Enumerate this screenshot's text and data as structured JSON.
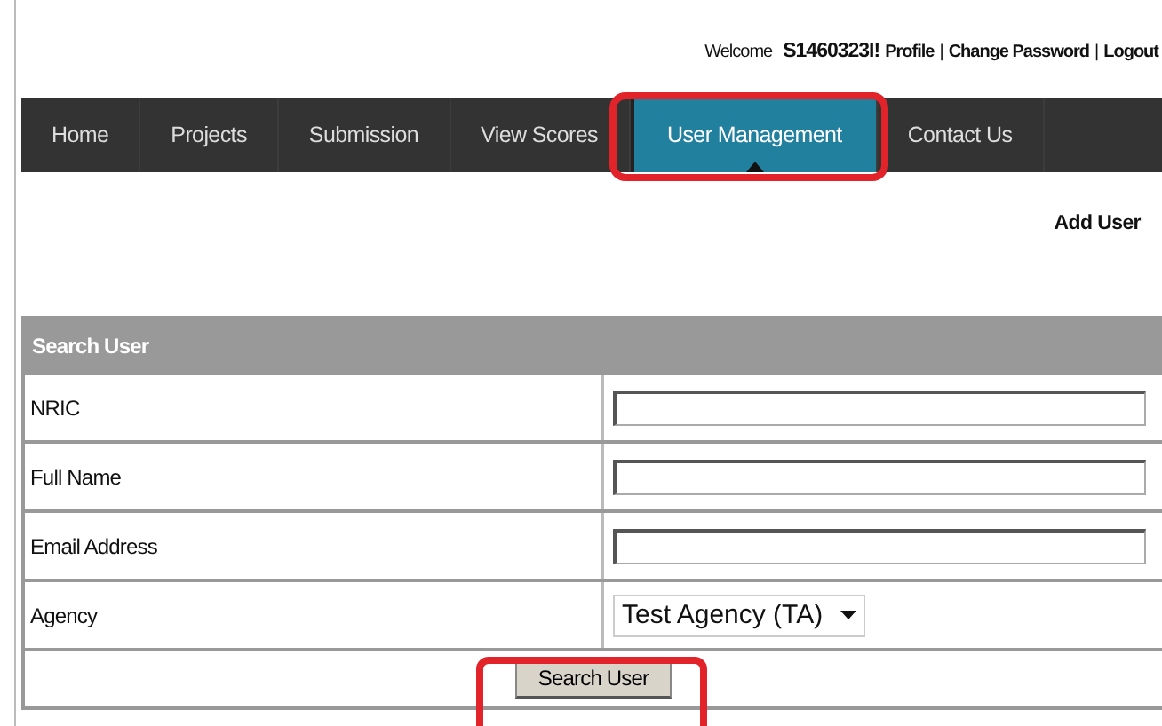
{
  "header": {
    "greeting": "Welcome",
    "user": "S1460323I!",
    "links": [
      {
        "label": "Profile"
      },
      {
        "label": "Change Password"
      },
      {
        "label": "Logout"
      }
    ],
    "separator": "|"
  },
  "nav": [
    {
      "label": "Home",
      "selected": false,
      "highlighted": false
    },
    {
      "label": "Projects",
      "selected": false,
      "highlighted": false
    },
    {
      "label": "Submission",
      "selected": false,
      "highlighted": false
    },
    {
      "label": "View Scores",
      "selected": false,
      "highlighted": false
    },
    {
      "label": "User Management",
      "selected": true,
      "highlighted": true
    },
    {
      "label": "Contact Us",
      "selected": false,
      "highlighted": false
    }
  ],
  "add_user": "Add User",
  "form": {
    "title": "Search User",
    "fields": [
      {
        "kind": "text",
        "label": "NRIC"
      },
      {
        "kind": "text",
        "label": "Full Name"
      },
      {
        "kind": "text",
        "label": "Email Address"
      },
      {
        "kind": "select",
        "label": "Agency",
        "value": "Test Agency (TA)"
      }
    ],
    "button": {
      "label": "Search User",
      "highlighted": true
    }
  }
}
